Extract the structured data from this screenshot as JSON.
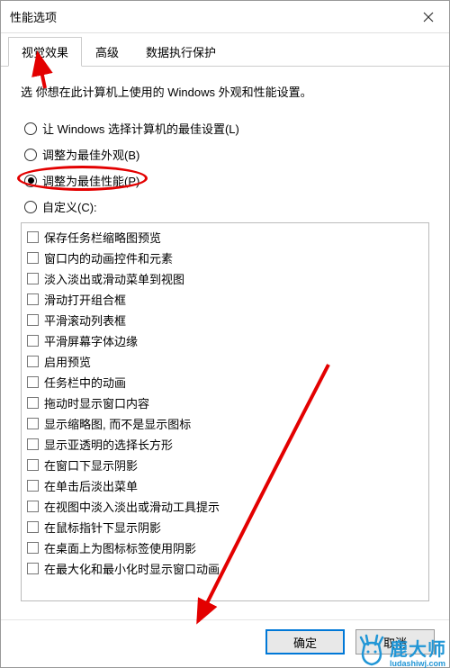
{
  "window": {
    "title": "性能选项"
  },
  "tabs": {
    "items": [
      {
        "label": "视觉效果",
        "active": true
      },
      {
        "label": "高级",
        "active": false
      },
      {
        "label": "数据执行保护",
        "active": false
      }
    ]
  },
  "description": "选    你想在此计算机上使用的 Windows 外观和性能设置。",
  "radios": {
    "items": [
      {
        "label": "让 Windows 选择计算机的最佳设置(L)",
        "checked": false
      },
      {
        "label": "调整为最佳外观(B)",
        "checked": false
      },
      {
        "label": "调整为最佳性能(P)",
        "checked": true,
        "highlight": true
      },
      {
        "label": "自定义(C):",
        "checked": false
      }
    ]
  },
  "checkboxes": {
    "items": [
      {
        "label": "保存任务栏缩略图预览"
      },
      {
        "label": "窗口内的动画控件和元素"
      },
      {
        "label": "淡入淡出或滑动菜单到视图"
      },
      {
        "label": "滑动打开组合框"
      },
      {
        "label": "平滑滚动列表框"
      },
      {
        "label": "平滑屏幕字体边缘"
      },
      {
        "label": "启用预览"
      },
      {
        "label": "任务栏中的动画"
      },
      {
        "label": "拖动时显示窗口内容"
      },
      {
        "label": "显示缩略图, 而不是显示图标"
      },
      {
        "label": "显示亚透明的选择长方形"
      },
      {
        "label": "在窗口下显示阴影"
      },
      {
        "label": "在单击后淡出菜单"
      },
      {
        "label": "在视图中淡入淡出或滑动工具提示"
      },
      {
        "label": "在鼠标指针下显示阴影"
      },
      {
        "label": "在桌面上为图标标签使用阴影"
      },
      {
        "label": "在最大化和最小化时显示窗口动画"
      }
    ]
  },
  "buttons": {
    "ok": "确定",
    "cancel": "取消"
  },
  "watermark": {
    "brand": "鹿大师",
    "url": "ludashiwj.com"
  }
}
